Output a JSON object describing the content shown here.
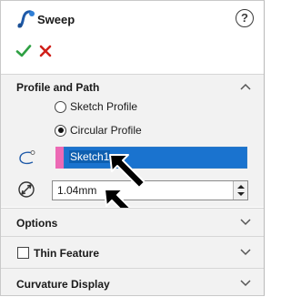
{
  "header": {
    "title": "Sweep",
    "help_label": "?",
    "icons": {
      "feature": "sweep-feature-icon",
      "ok": "check-icon",
      "cancel": "close-icon"
    }
  },
  "profile_and_path": {
    "title": "Profile and Path",
    "options": [
      {
        "label": "Sketch Profile",
        "selected": false
      },
      {
        "label": "Circular Profile",
        "selected": true
      }
    ],
    "path_selection": "Sketch1",
    "diameter": "1.04mm",
    "colors": {
      "swatch": "#ec6ab5",
      "selection": "#1a73cf"
    }
  },
  "options_section": {
    "title": "Options"
  },
  "thin_feature": {
    "title": "Thin Feature",
    "checked": false
  },
  "curvature_display": {
    "title": "Curvature Display"
  }
}
